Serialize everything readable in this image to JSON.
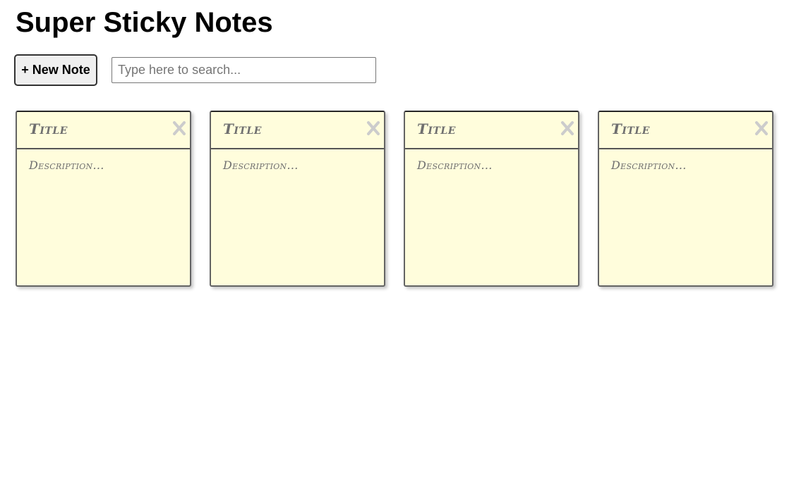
{
  "app": {
    "title": "Super Sticky Notes"
  },
  "toolbar": {
    "new_note_label": "+ New Note",
    "search_placeholder": "Type here to search...",
    "search_value": ""
  },
  "notes": [
    {
      "title": "Title",
      "description": "Description...",
      "close_icon": "close-icon"
    },
    {
      "title": "Title",
      "description": "Description...",
      "close_icon": "close-icon"
    },
    {
      "title": "Title",
      "description": "Description...",
      "close_icon": "close-icon"
    },
    {
      "title": "Title",
      "description": "Description...",
      "close_icon": "close-icon"
    }
  ],
  "colors": {
    "note_background": "#fffddc",
    "note_text": "#6f6f6f",
    "close_icon": "#cccccc"
  }
}
